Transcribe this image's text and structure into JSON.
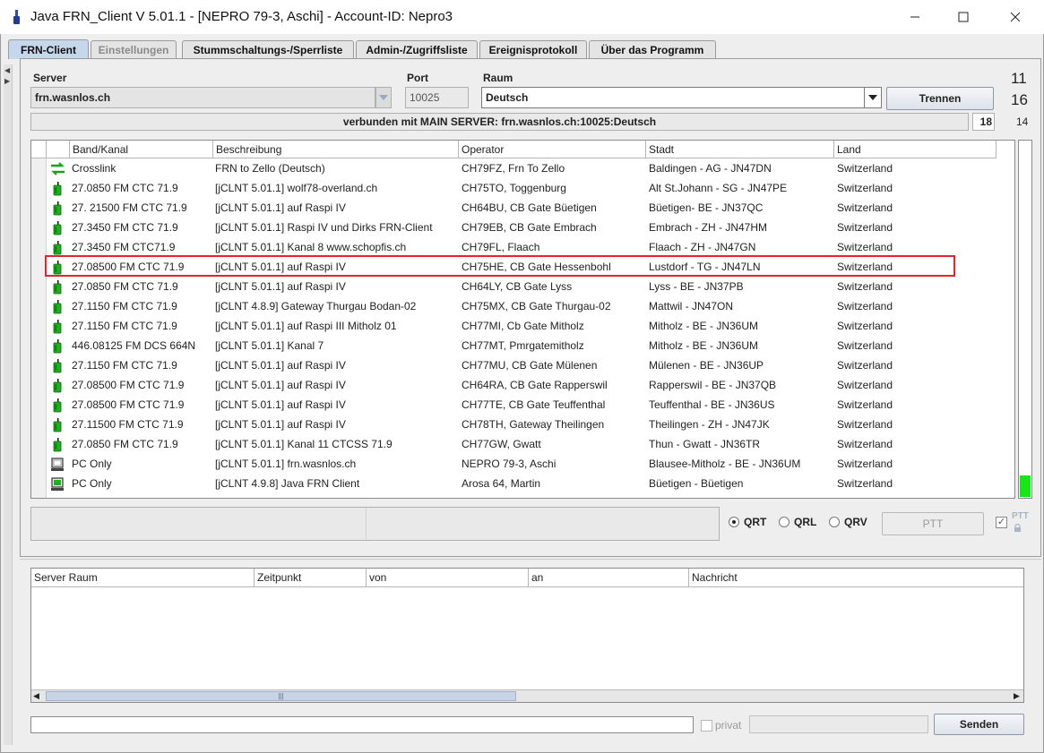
{
  "window": {
    "title": "Java FRN_Client V 5.01.1 - [NEPRO 79-3, Aschi] - Account-ID: Nepro3",
    "minimize_label": "—",
    "maximize_label": "☐",
    "close_label": "✕"
  },
  "tabs": [
    {
      "label": "FRN-Client",
      "state": "active"
    },
    {
      "label": "Einstellungen",
      "state": "disabled"
    },
    {
      "label": "Stummschaltungs-/Sperrliste",
      "state": "normal"
    },
    {
      "label": "Admin-/Zugriffsliste",
      "state": "normal"
    },
    {
      "label": "Ereignisprotokoll",
      "state": "normal"
    },
    {
      "label": "Über das Programm",
      "state": "normal"
    }
  ],
  "connection": {
    "server_label": "Server",
    "server_value": "frn.wasnlos.ch",
    "port_label": "Port",
    "port_value": "10025",
    "room_label": "Raum",
    "room_value": "Deutsch",
    "disconnect_button": "Trennen",
    "status_text": "verbunden mit  MAIN SERVER: frn.wasnlos.ch:10025:Deutsch",
    "count_room": "18",
    "count_a": "11",
    "count_b": "16",
    "count_c": "14"
  },
  "clients": {
    "columns": [
      "Band/Kanal",
      "Beschreibung",
      "Operator",
      "Stadt",
      "Land"
    ],
    "rows": [
      {
        "icon": "crosslink-icon",
        "band": "Crosslink",
        "desc": "FRN to Zello (Deutsch)",
        "operator": "CH79FZ, Frn To Zello",
        "city": "Baldingen - AG - JN47DN",
        "country": "Switzerland"
      },
      {
        "icon": "radio-gateway-icon",
        "band": "27.0850 FM CTC 71.9",
        "desc": "[jCLNT 5.01.1] wolf78-overland.ch",
        "operator": "CH75TO, Toggenburg",
        "city": "Alt St.Johann - SG - JN47PE",
        "country": "Switzerland"
      },
      {
        "icon": "radio-gateway-icon",
        "band": "27. 21500 FM CTC 71.9",
        "desc": "[jCLNT 5.01.1] auf Raspi IV",
        "operator": "CH64BU, CB Gate Büetigen",
        "city": "Büetigen- BE - JN37QC",
        "country": "Switzerland"
      },
      {
        "icon": "radio-gateway-icon",
        "band": "27.3450 FM CTC 71.9",
        "desc": "[jCLNT 5.01.1] Raspi IV und Dirks FRN-Client",
        "operator": "CH79EB, CB Gate Embrach",
        "city": "Embrach - ZH - JN47HM",
        "country": "Switzerland"
      },
      {
        "icon": "radio-gateway-icon",
        "band": "27.3450 FM CTC71.9",
        "desc": "[jCLNT 5.01.1] Kanal 8  www.schopfis.ch",
        "operator": "CH79FL, Flaach",
        "city": "Flaach - ZH - JN47GN",
        "country": "Switzerland"
      },
      {
        "icon": "radio-gateway-icon",
        "band": "27.08500 FM CTC 71.9",
        "desc": "[jCLNT 5.01.1] auf Raspi IV",
        "operator": "CH75HE, CB Gate Hessenbohl",
        "city": "Lustdorf - TG - JN47LN",
        "country": "Switzerland"
      },
      {
        "icon": "radio-gateway-icon",
        "band": "27.0850 FM CTC 71.9",
        "desc": "[jCLNT 5.01.1] auf Raspi IV",
        "operator": "CH64LY, CB Gate Lyss",
        "city": "Lyss - BE - JN37PB",
        "country": "Switzerland"
      },
      {
        "icon": "radio-gateway-icon",
        "band": "27.1150 FM CTC 71.9",
        "desc": "[jCLNT 4.8.9] Gateway Thurgau Bodan-02",
        "operator": "CH75MX, CB Gate Thurgau-02",
        "city": "Mattwil - JN47ON",
        "country": "Switzerland"
      },
      {
        "icon": "radio-gateway-icon",
        "band": "27.1150 FM CTC 71.9",
        "desc": "[jCLNT 5.01.1] auf Raspi III  Mitholz 01",
        "operator": "CH77MI, Cb Gate Mitholz",
        "city": "Mitholz - BE - JN36UM",
        "country": "Switzerland"
      },
      {
        "icon": "radio-gateway-icon",
        "band": "446.08125 FM DCS 664N",
        "desc": "[jCLNT 5.01.1] Kanal 7",
        "operator": "CH77MT, Pmrgatemitholz",
        "city": "Mitholz - BE - JN36UM",
        "country": "Switzerland"
      },
      {
        "icon": "radio-gateway-icon",
        "band": "27.1150 FM CTC 71.9",
        "desc": "[jCLNT 5.01.1] auf Raspi IV",
        "operator": "CH77MU, CB Gate Mülenen",
        "city": "Mülenen - BE - JN36UP",
        "country": "Switzerland"
      },
      {
        "icon": "radio-gateway-icon",
        "band": "27.08500 FM CTC 71.9",
        "desc": "[jCLNT 5.01.1] auf Raspi IV",
        "operator": "CH64RA, CB Gate Rapperswil",
        "city": "Rapperswil - BE - JN37QB",
        "country": "Switzerland"
      },
      {
        "icon": "radio-gateway-icon",
        "band": "27.08500 FM CTC 71.9",
        "desc": "[jCLNT 5.01.1] auf Raspi IV",
        "operator": "CH77TE, CB Gate Teuffenthal",
        "city": "Teuffenthal - BE - JN36US",
        "country": "Switzerland"
      },
      {
        "icon": "radio-gateway-icon",
        "band": "27.11500 FM CTC 71.9",
        "desc": "[jCLNT 5.01.1] auf Raspi IV",
        "operator": "CH78TH, Gateway Theilingen",
        "city": "Theilingen - ZH - JN47JK",
        "country": "Switzerland"
      },
      {
        "icon": "radio-gateway-icon",
        "band": "27.0850 FM CTC 71.9",
        "desc": "[jCLNT 5.01.1] Kanal 11 CTCSS 71.9",
        "operator": "CH77GW, Gwatt",
        "city": "Thun - Gwatt - JN36TR",
        "country": "Switzerland"
      },
      {
        "icon": "pc-icon",
        "band": "PC Only",
        "desc": "[jCLNT 5.01.1] frn.wasnlos.ch",
        "operator": "NEPRO 79-3, Aschi",
        "city": "Blausee-Mitholz - BE - JN36UM",
        "country": "Switzerland"
      },
      {
        "icon": "pc-active-icon",
        "band": "PC Only",
        "desc": "[jCLNT 4.9.8] Java FRN Client",
        "operator": "Arosa 64, Martin",
        "city": "Büetigen - Büetigen",
        "country": "Switzerland"
      }
    ],
    "selected_index": 5
  },
  "level_meter": {
    "fraction": 0.06,
    "color": "#19e619"
  },
  "transmit": {
    "modes": [
      {
        "label": "QRT",
        "selected": true
      },
      {
        "label": "QRL",
        "selected": false
      },
      {
        "label": "QRV",
        "selected": false
      }
    ],
    "ptt_button": "PTT",
    "ptt_lock_label": "PTT",
    "ptt_lock_checked": true
  },
  "messages": {
    "columns": [
      "Server Raum",
      "Zeitpunkt",
      "von",
      "an",
      "Nachricht"
    ],
    "scroll_grip": "|||",
    "input_value": "",
    "private_label": "privat",
    "send_button": "Senden"
  },
  "colors": {
    "selection_border": "#e0262b",
    "active_tab": "#c6d7ec",
    "gateway_green": "#1db21d"
  }
}
